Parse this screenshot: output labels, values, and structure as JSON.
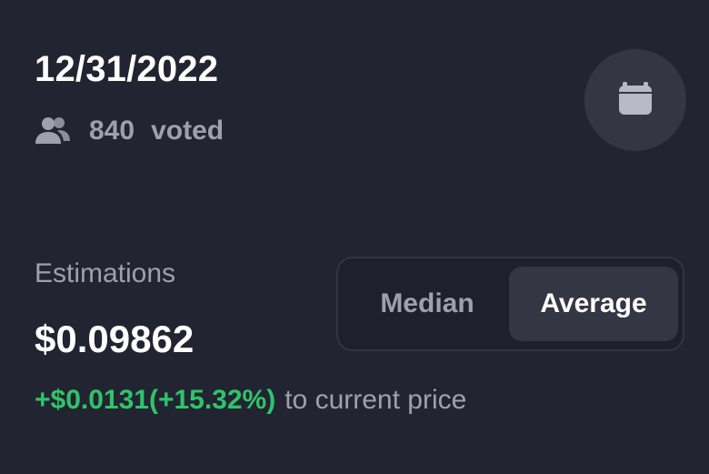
{
  "forecast": {
    "date": "12/31/2022",
    "votes_count": "840",
    "votes_label": "voted"
  },
  "estimations": {
    "label": "Estimations",
    "value": "$0.09862",
    "change": "+$0.0131(+15.32%)",
    "change_suffix": "to current price"
  },
  "toggle": {
    "options": [
      "Median",
      "Average"
    ],
    "selected": "Average"
  },
  "icons": {
    "voters": "users-icon",
    "calendar_button": "calendar-icon"
  },
  "colors": {
    "background": "#222431",
    "positive": "#2fc46a",
    "muted_text": "#9ea0ad",
    "primary_text": "#ffffff",
    "surface": "#343643"
  }
}
